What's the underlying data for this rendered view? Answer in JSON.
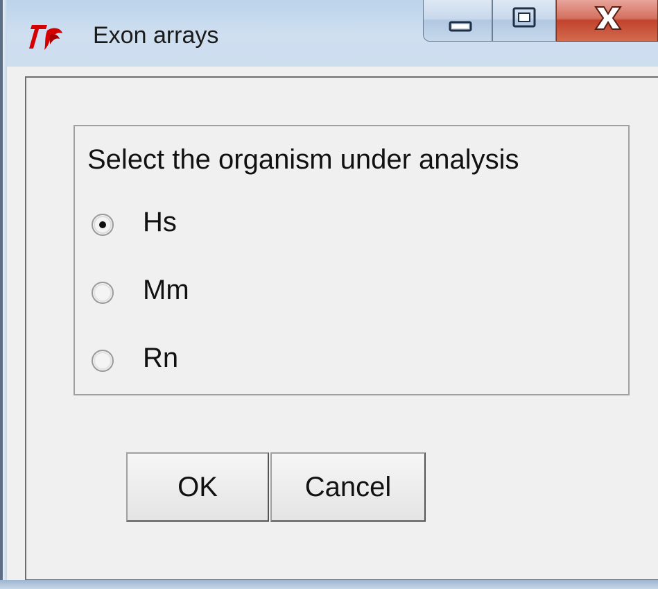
{
  "window": {
    "title": "Exon arrays",
    "app_icon": "tk-feather-icon"
  },
  "caption_buttons": {
    "minimize_icon": "minimize-icon",
    "maximize_icon": "maximize-icon",
    "close_icon": "close-icon"
  },
  "group": {
    "label": "Select the organism under analysis",
    "options": [
      {
        "label": "Hs",
        "selected": true
      },
      {
        "label": "Mm",
        "selected": false
      },
      {
        "label": "Rn",
        "selected": false
      }
    ]
  },
  "buttons": {
    "ok_label": "OK",
    "cancel_label": "Cancel"
  },
  "colors": {
    "tk_logo": "#d40000",
    "close_button": "#c2432d",
    "dialog_background": "#f0f0f0"
  }
}
